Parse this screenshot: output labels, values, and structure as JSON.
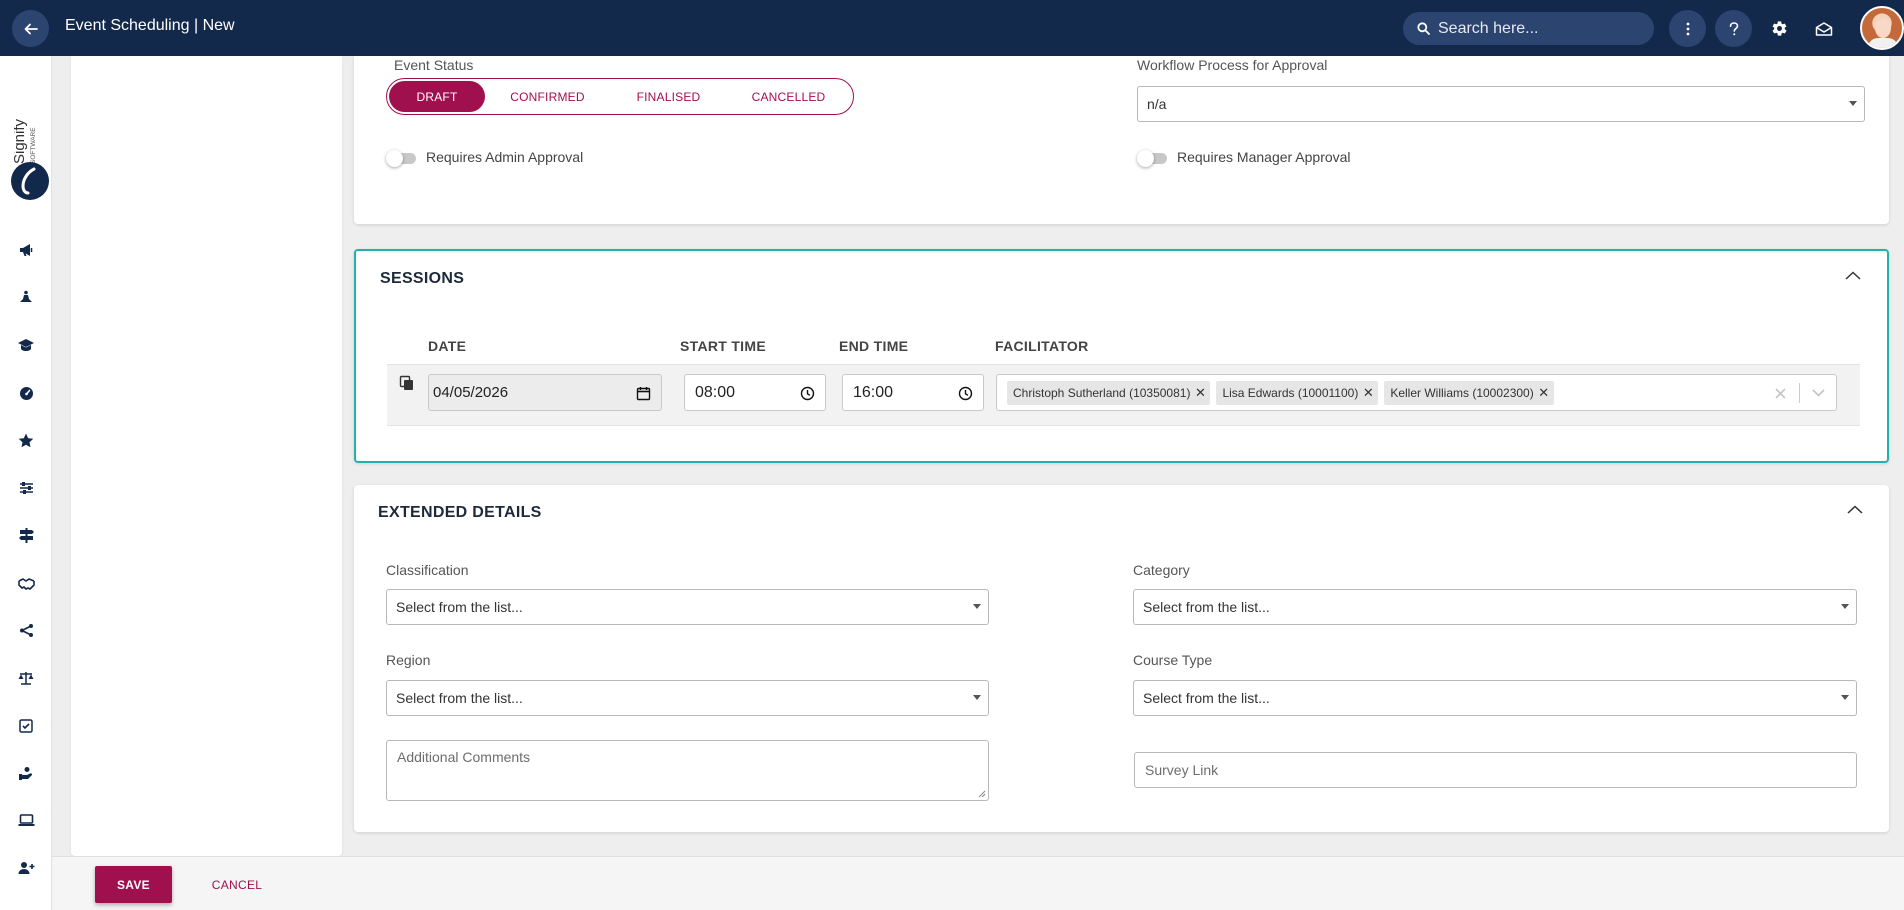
{
  "topbar": {
    "title": "Event Scheduling | New",
    "search_placeholder": "Search here...",
    "icons": [
      "back-arrow-icon",
      "search-icon",
      "more-vertical-icon",
      "help-icon",
      "gear-icon",
      "mail-icon",
      "avatar"
    ]
  },
  "brand": {
    "logo_text": "Signify",
    "logo_subtext": "SOFTWARE",
    "primary_color": "#a0104f",
    "header_color": "#13294b",
    "highlight_color": "#20b3ad"
  },
  "nav_rail": {
    "icons": [
      "megaphone-icon",
      "meditation-icon",
      "graduation-cap-icon",
      "dashboard-gauge-icon",
      "star-icon",
      "sliders-icon",
      "signpost-icon",
      "handshake-icon",
      "hierarchy-icon",
      "scales-icon",
      "checklist-icon",
      "hand-coins-icon",
      "laptop-icon",
      "add-user-icon"
    ]
  },
  "event_status": {
    "label": "Event Status",
    "options": [
      "DRAFT",
      "CONFIRMED",
      "FINALISED",
      "CANCELLED"
    ],
    "selected": "DRAFT"
  },
  "workflow": {
    "label": "Workflow Process for Approval",
    "value": "n/a"
  },
  "toggles": {
    "admin_approval": "Requires Admin Approval",
    "manager_approval": "Requires Manager Approval"
  },
  "sessions": {
    "title": "SESSIONS",
    "columns": {
      "date": "DATE",
      "start_time": "START TIME",
      "end_time": "END TIME",
      "facilitator": "FACILITATOR"
    },
    "rows": [
      {
        "date": "04/05/2026",
        "start_time": "08:00",
        "end_time": "16:00",
        "facilitators": [
          "Christoph Sutherland (10350081)",
          "Lisa Edwards (10001100)",
          "Keller Williams (10002300)"
        ]
      }
    ]
  },
  "extended": {
    "title": "EXTENDED DETAILS",
    "classification_label": "Classification",
    "classification_value": "Select from the list...",
    "category_label": "Category",
    "category_value": "Select from the list...",
    "region_label": "Region",
    "region_value": "Select from the list...",
    "course_type_label": "Course Type",
    "course_type_value": "Select from the list...",
    "comments_placeholder": "Additional Comments",
    "survey_placeholder": "Survey Link"
  },
  "footer": {
    "save": "SAVE",
    "cancel": "CANCEL"
  }
}
